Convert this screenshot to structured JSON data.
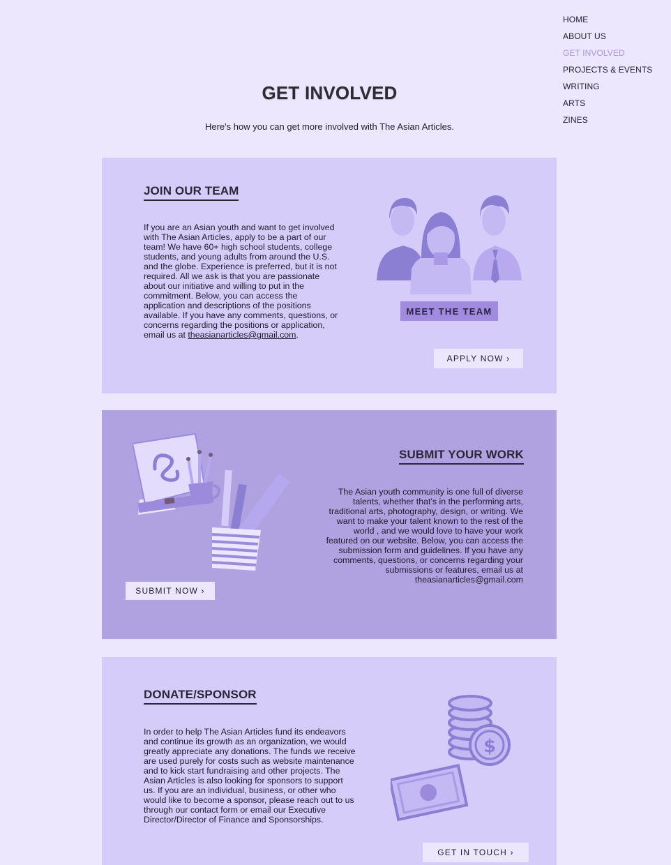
{
  "nav": {
    "items": [
      {
        "label": "HOME"
      },
      {
        "label": "ABOUT US"
      },
      {
        "label": "GET INVOLVED"
      },
      {
        "label": "PROJECTS & EVENTS"
      },
      {
        "label": "WRITING"
      },
      {
        "label": "ARTS"
      },
      {
        "label": "ZINES"
      }
    ],
    "active_index": 2
  },
  "page": {
    "title": "GET INVOLVED",
    "subtitle": "Here's how you can get more involved with The Asian Articles."
  },
  "join": {
    "heading": "JOIN OUR TEAM",
    "body": "If you are an Asian youth and want to get involved with The Asian Articles, apply to be a part of our team! We have 60+ high school students, college students, and young adults from around the U.S. and the globe. Experience is preferred, but it is not required. All we ask is that you are passionate about our initiative and willing to put in the commitment. Below, you can access the application and descriptions of the positions available. If you have any comments, questions, or concerns regarding the positions or application, email us at ",
    "email": "theasianarticles@gmail.com",
    "body_end": ".",
    "meet_button": "MEET THE TEAM",
    "apply_button": "APPLY NOW ›",
    "icon": "team-people-icon"
  },
  "submit": {
    "heading": "SUBMIT YOUR WORK",
    "body": "The Asian youth community is one full of diverse talents, whether that's in the performing arts, traditional arts, photography, design, or writing. We want to make your talent known to the rest of the world , and we would love to have your work featured on our website. Below, you can access the submission form and guidelines. If you have any comments, questions, or concerns regarding your submissions or features, email us at theasianarticles@gmail.com",
    "button": "SUBMIT NOW ›",
    "icon": "art-supplies-icon"
  },
  "donate": {
    "heading": "DONATE/SPONSOR",
    "body": "In order to help The Asian Articles fund its endeavors and continue its growth as an organization, we would greatly appreciate any donations. The funds we receive are used purely for costs such as website maintenance and to kick start fundraising and other projects. The Asian Articles is also looking for sponsors to support us. If you are an individual, business, or other who would like to become a sponsor, please reach out to us through our contact form or email our Executive Director/Director of Finance and Sponsorships.",
    "button": "GET IN TOUCH ›",
    "icon": "money-coins-icon"
  },
  "colors": {
    "page_bg": "#ece7fd",
    "card_light": "#d6ccfa",
    "card_dark": "#b0a2e0",
    "accent": "#a08be0",
    "nav_active": "#a896d8"
  }
}
